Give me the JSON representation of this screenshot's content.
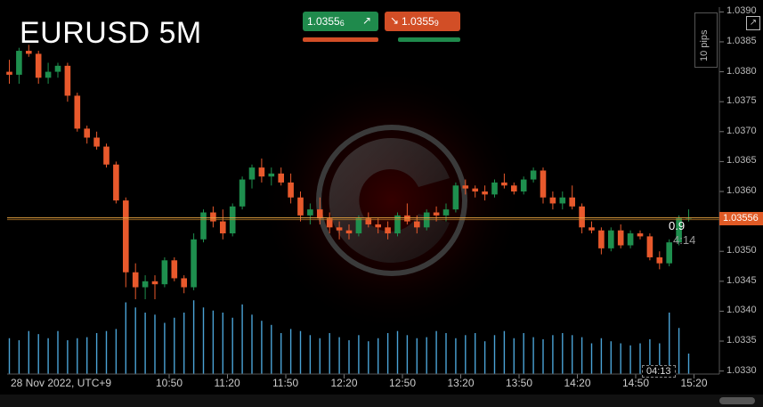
{
  "title": "EURUSD 5M",
  "trade": {
    "buy_price": "1.0355",
    "buy_pipette": "6",
    "buy_icon": "arrow-up-right-icon",
    "sell_price": "1.0355",
    "sell_pipette": "9",
    "sell_icon": "arrow-down-right-icon",
    "buy_color": "#1f8a4c",
    "sell_color": "#d24e26"
  },
  "pips_label": "10 pips",
  "current_price": "1.03556",
  "spread": "0.9",
  "timer": "4:14",
  "cursor_time": "04:13",
  "x_axis": {
    "date_label": "28 Nov 2022, UTC+9",
    "ticks": [
      "10:50",
      "11:20",
      "11:50",
      "12:20",
      "12:50",
      "13:20",
      "13:50",
      "14:20",
      "14:50",
      "15:20"
    ]
  },
  "colors": {
    "bull": "#1e8f4e",
    "bear": "#e8592c",
    "volume": "#4aa3d6",
    "price_line": "#e05a25"
  },
  "chart_data": {
    "type": "candlestick",
    "title": "EURUSD 5M",
    "y_ticks": [
      "1.0390",
      "1.0385",
      "1.0380",
      "1.0375",
      "1.0370",
      "1.0365",
      "1.0360",
      "1.0355",
      "1.0350",
      "1.0345",
      "1.0340",
      "1.0335",
      "1.0330"
    ],
    "ylim": [
      1.03295,
      1.03905
    ],
    "candles": [
      [
        1.038,
        1.0382,
        1.0378,
        1.03795
      ],
      [
        1.03795,
        1.0384,
        1.0378,
        1.03835
      ],
      [
        1.03835,
        1.03845,
        1.03825,
        1.0383
      ],
      [
        1.0383,
        1.03835,
        1.0378,
        1.0379
      ],
      [
        1.0379,
        1.03815,
        1.0378,
        1.038
      ],
      [
        1.038,
        1.03815,
        1.0379,
        1.0381
      ],
      [
        1.0381,
        1.03815,
        1.0375,
        1.0376
      ],
      [
        1.0376,
        1.03765,
        1.037,
        1.03705
      ],
      [
        1.03705,
        1.0371,
        1.0368,
        1.0369
      ],
      [
        1.0369,
        1.037,
        1.0367,
        1.03675
      ],
      [
        1.03675,
        1.0368,
        1.0364,
        1.03645
      ],
      [
        1.03645,
        1.0365,
        1.0358,
        1.03585
      ],
      [
        1.03585,
        1.0359,
        1.0344,
        1.03465
      ],
      [
        1.03465,
        1.0348,
        1.0342,
        1.0344
      ],
      [
        1.0344,
        1.0346,
        1.0342,
        1.0345
      ],
      [
        1.0345,
        1.0346,
        1.0342,
        1.03445
      ],
      [
        1.03445,
        1.0349,
        1.0344,
        1.03485
      ],
      [
        1.03485,
        1.0349,
        1.0345,
        1.03455
      ],
      [
        1.03455,
        1.0346,
        1.0343,
        1.0344
      ],
      [
        1.0344,
        1.0353,
        1.03435,
        1.0352
      ],
      [
        1.0352,
        1.0357,
        1.03515,
        1.03565
      ],
      [
        1.03565,
        1.03575,
        1.0354,
        1.0355
      ],
      [
        1.0355,
        1.0357,
        1.0352,
        1.0353
      ],
      [
        1.0353,
        1.0358,
        1.03525,
        1.03575
      ],
      [
        1.03575,
        1.03625,
        1.0357,
        1.0362
      ],
      [
        1.0362,
        1.03645,
        1.03605,
        1.0364
      ],
      [
        1.0364,
        1.03655,
        1.03615,
        1.03625
      ],
      [
        1.03625,
        1.0364,
        1.0361,
        1.0363
      ],
      [
        1.0363,
        1.0364,
        1.0361,
        1.03615
      ],
      [
        1.03615,
        1.0363,
        1.0358,
        1.0359
      ],
      [
        1.0359,
        1.036,
        1.0355,
        1.0356
      ],
      [
        1.0356,
        1.0358,
        1.03545,
        1.0357
      ],
      [
        1.0357,
        1.0359,
        1.03545,
        1.03555
      ],
      [
        1.03555,
        1.03565,
        1.0353,
        1.0354
      ],
      [
        1.0354,
        1.0355,
        1.0352,
        1.03535
      ],
      [
        1.03535,
        1.03545,
        1.0352,
        1.0353
      ],
      [
        1.0353,
        1.0356,
        1.03525,
        1.03555
      ],
      [
        1.03555,
        1.03565,
        1.0354,
        1.03545
      ],
      [
        1.03545,
        1.03555,
        1.0353,
        1.0354
      ],
      [
        1.0354,
        1.0355,
        1.0352,
        1.0353
      ],
      [
        1.0353,
        1.03565,
        1.03525,
        1.0356
      ],
      [
        1.0356,
        1.0358,
        1.03545,
        1.0355
      ],
      [
        1.0355,
        1.0356,
        1.0353,
        1.0354
      ],
      [
        1.0354,
        1.0357,
        1.03535,
        1.03565
      ],
      [
        1.03565,
        1.03575,
        1.0355,
        1.0356
      ],
      [
        1.0356,
        1.0358,
        1.0355,
        1.0357
      ],
      [
        1.0357,
        1.03615,
        1.03565,
        1.0361
      ],
      [
        1.0361,
        1.0362,
        1.03595,
        1.03605
      ],
      [
        1.03605,
        1.0361,
        1.0359,
        1.036
      ],
      [
        1.036,
        1.0361,
        1.03585,
        1.03595
      ],
      [
        1.03595,
        1.0362,
        1.0359,
        1.03615
      ],
      [
        1.03615,
        1.0363,
        1.03605,
        1.0361
      ],
      [
        1.0361,
        1.03615,
        1.03595,
        1.036
      ],
      [
        1.036,
        1.03625,
        1.03595,
        1.0362
      ],
      [
        1.0362,
        1.0364,
        1.03615,
        1.03635
      ],
      [
        1.03635,
        1.0364,
        1.0358,
        1.0359
      ],
      [
        1.0359,
        1.036,
        1.0357,
        1.0358
      ],
      [
        1.0358,
        1.036,
        1.0357,
        1.0359
      ],
      [
        1.0359,
        1.0361,
        1.0357,
        1.03575
      ],
      [
        1.03575,
        1.0358,
        1.0353,
        1.0354
      ],
      [
        1.0354,
        1.0355,
        1.0353,
        1.03535
      ],
      [
        1.03535,
        1.0354,
        1.03495,
        1.03505
      ],
      [
        1.03505,
        1.0354,
        1.035,
        1.03535
      ],
      [
        1.03535,
        1.03545,
        1.03505,
        1.0351
      ],
      [
        1.0351,
        1.03535,
        1.03505,
        1.0353
      ],
      [
        1.0353,
        1.03535,
        1.0352,
        1.03525
      ],
      [
        1.03525,
        1.0353,
        1.03485,
        1.0349
      ],
      [
        1.0349,
        1.035,
        1.0347,
        1.0348
      ],
      [
        1.0348,
        1.0352,
        1.03475,
        1.03515
      ],
      [
        1.03515,
        1.0356,
        1.0351,
        1.03555
      ],
      [
        1.03555,
        1.0357,
        1.0355,
        1.03556
      ]
    ],
    "volume_relative": [
      0.35,
      0.33,
      0.42,
      0.39,
      0.35,
      0.42,
      0.33,
      0.35,
      0.36,
      0.4,
      0.42,
      0.44,
      0.7,
      0.65,
      0.6,
      0.58,
      0.5,
      0.55,
      0.6,
      0.72,
      0.65,
      0.62,
      0.6,
      0.55,
      0.68,
      0.58,
      0.52,
      0.48,
      0.4,
      0.44,
      0.42,
      0.38,
      0.35,
      0.4,
      0.36,
      0.33,
      0.38,
      0.32,
      0.35,
      0.4,
      0.42,
      0.38,
      0.35,
      0.36,
      0.42,
      0.4,
      0.35,
      0.38,
      0.4,
      0.32,
      0.38,
      0.42,
      0.35,
      0.4,
      0.36,
      0.34,
      0.38,
      0.4,
      0.38,
      0.36,
      0.3,
      0.35,
      0.32,
      0.3,
      0.28,
      0.3,
      0.34,
      0.3,
      0.6,
      0.45,
      0.2
    ]
  }
}
